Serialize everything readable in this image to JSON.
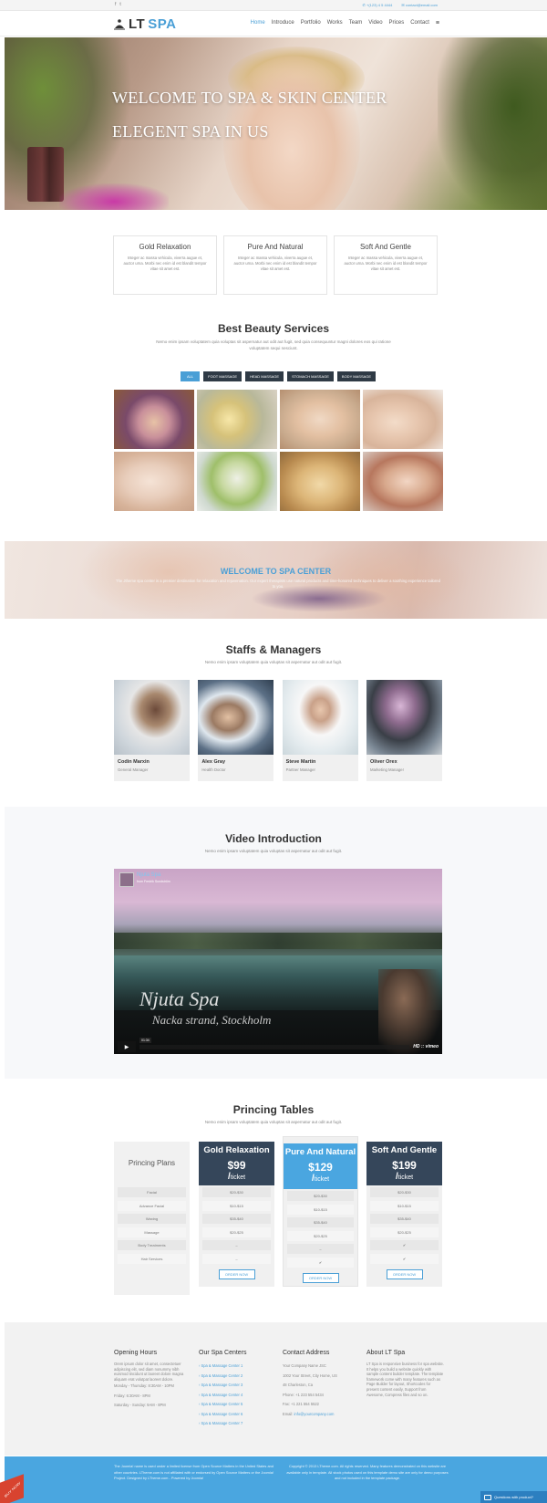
{
  "topbar": {
    "social": [
      "f",
      "t"
    ],
    "phone": "+(123) 4 5 4444",
    "email": "contact@email.com"
  },
  "logo": {
    "lt": "LT",
    "spa": "SPA"
  },
  "nav": [
    "Home",
    "Introduce",
    "Portfolio",
    "Works",
    "Team",
    "Video",
    "Prices",
    "Contact"
  ],
  "nav_menu_icon": "≡",
  "hero": {
    "line1": "WELCOME TO SPA & SKIN CENTER",
    "line2": "ELEGENT SPA IN US"
  },
  "features": [
    {
      "title": "Gold Relaxation",
      "text": "Integer ac massa vehicula, viverra augue et, auctor urna. Morbi nec enim id est blandit tempor vitae sit amet est."
    },
    {
      "title": "Pure And Natural",
      "text": "Integer ac massa vehicula, viverra augue et, auctor urna. Morbi nec enim id est blandit tempor vitae sit amet est."
    },
    {
      "title": "Soft And Gentle",
      "text": "Integer ac massa vehicula, viverra augue et, auctor urna. Morbi nec enim id est blandit tempor vitae sit amet est."
    }
  ],
  "services": {
    "title": "Best Beauty Services",
    "subtitle": "Nemo enim ipsam voluptatem quia voluptas sit aspernatur aut odit aut fugit, sed quia consequuntur magni dolores eos qui ratione voluptatem sequi nesciunt.",
    "filters": [
      "ALL",
      "FOOT MASSAGE",
      "HEAD MASSAGE",
      "STOMACH MASSAGE",
      "BODY MASSAGE"
    ]
  },
  "welcome": {
    "title": "WELCOME TO SPA CENTER",
    "text": "The Jtheme spa center is a premier destination for relaxation and rejuvenation. Our expert therapists use natural products and time-honored techniques to deliver a soothing experience tailored to you."
  },
  "staff": {
    "title": "Staffs & Managers",
    "subtitle": "Nemo enim ipsam voluptatem quia voluptas sit aspernatur aut odit aut fugit.",
    "members": [
      {
        "name": "Codin Marxin",
        "role": "General Manager"
      },
      {
        "name": "Alex Gray",
        "role": "Health Doctor"
      },
      {
        "name": "Steve Martin",
        "role": "Partner Manager"
      },
      {
        "name": "Oliver Orex",
        "role": "Marketing Manager"
      }
    ]
  },
  "video": {
    "title": "Video Introduction",
    "subtitle": "Nemo enim ipsam voluptatem quia voluptas sit aspernatur aut odit aut fugit.",
    "clip_title": "Njuta Spa",
    "clip_by": "from Fredrik Sundström",
    "script1": "Njuta Spa",
    "script2": "Nacka strand, Stockholm",
    "time": "01:34",
    "brand": "HD  ::  vimeo"
  },
  "pricing": {
    "title": "Princing Tables",
    "subtitle": "Nemo enim ipsam voluptatem quia voluptas sit aspernatur aut odit aut fugit.",
    "plans_label": "Princing Plans",
    "rows": [
      "Facial",
      "Advance Facial",
      "Waxing",
      "Massage",
      "Body Treatments",
      "Hair Services"
    ],
    "columns": [
      {
        "name": "Gold Relaxation",
        "price": "$99",
        "per": "ticket",
        "cells": [
          "$20-$30",
          "$10-$15",
          "$35-$40",
          "$20-$25",
          "–",
          "–"
        ],
        "button": "ORDER NOW"
      },
      {
        "name": "Pure And Natural",
        "price": "$129",
        "per": "ticket",
        "cells": [
          "$20-$30",
          "$10-$15",
          "$35-$40",
          "$20-$25",
          "–",
          "✔"
        ],
        "button": "ORDER NOW"
      },
      {
        "name": "Soft And Gentle",
        "price": "$199",
        "per": "ticket",
        "cells": [
          "$20-$30",
          "$10-$15",
          "$35-$40",
          "$20-$25",
          "✔",
          "✔"
        ],
        "button": "ORDER NOW"
      }
    ]
  },
  "footer": {
    "hours": {
      "title": "Opening Hours",
      "text": "Orem ipsum dolor sit amet, consectetuer adipiscing elit, sed diam nonummy nibh euismod tincidunt ut laoreet dolore magna aliquam erat volutpat laoreet dolore.",
      "lines": [
        "Monday - Thursday: 8:30AM - 10PM",
        "Friday: 6:30AM - 8PM",
        "Saturday - Sunday: 9AM - 8PM"
      ]
    },
    "centers": {
      "title": "Our Spa Centers",
      "links": [
        "Spa & Massage Center 1",
        "Spa & Massage Center 2",
        "Spa & Massage Center 3",
        "Spa & Massage Center 4",
        "Spa & Massage Center 5",
        "Spa & Massage Center 6",
        "Spa & Massage Center 7"
      ]
    },
    "contact": {
      "title": "Contact Address",
      "lines": [
        "Your Company Name JSC",
        "1002 Your Street, City Home, US",
        "48 Charleston, Ca",
        "Phone: +1 223 554 5434",
        "Fax: +1 221 554 5522"
      ],
      "email_label": "Email:",
      "email": "info@yourcompany.com"
    },
    "about": {
      "title": "About LT Spa",
      "text": "LT Spa is responsive business for spa website. It helps you build a website quickly with sample content builder template. The template framework come with many features such as Page Builder for layout, Shortcodes for present content easily, Support from Awesome, Compress files and so on."
    },
    "bottom_left": "The Joomla! name is used under a limited license from Open Source Matters in the United States and other countries. LTheme.com is not affiliated with or endorsed by Open Source Matters or the Joomla! Project. Designed by LTheme.com - Powered by Joomla!",
    "bottom_right": "Copyright © 2013 LTheme.com. All rights reserved. Many features demonstrated on this website are available only in template. All stock photos used on this template demo site are only for demo purposes and not included in the template package.",
    "ribbon": "BUY NOW",
    "chat": "Questions with product?"
  },
  "colors": {
    "accent": "#4a9fd6",
    "dark_header": "#35465a",
    "footer_bar": "#4aa6e0"
  }
}
